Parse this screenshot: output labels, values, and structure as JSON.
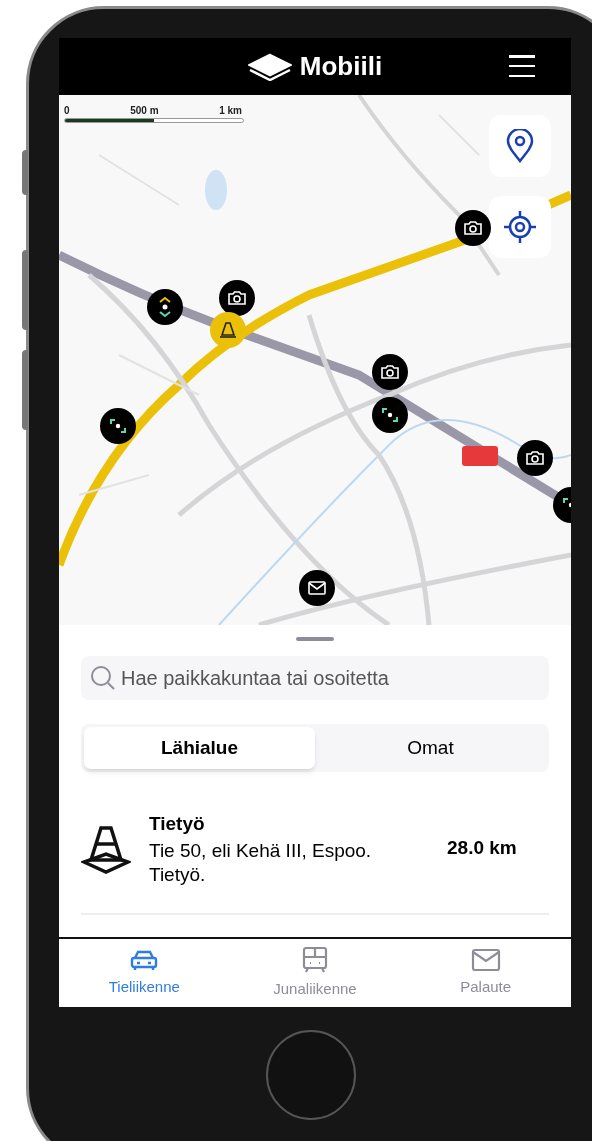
{
  "header": {
    "title": "Mobiili"
  },
  "map": {
    "kind": "picture",
    "scale": [
      "0",
      "500 m",
      "1 km"
    ]
  },
  "search": {
    "placeholder": "Hae paikkakuntaa tai osoitetta"
  },
  "segments": [
    {
      "label": "Lähialue",
      "selected": true
    },
    {
      "label": "Omat",
      "selected": false
    }
  ],
  "items": [
    {
      "title": "Tietyö",
      "description": "Tie 50, eli Kehä III, Espoo. Tietyö.",
      "distance": "28.0 km"
    }
  ],
  "tabs": [
    {
      "label": "Tieliikenne",
      "kind": "car",
      "selected": true
    },
    {
      "label": "Junaliikenne",
      "kind": "train",
      "selected": false
    },
    {
      "label": "Palaute",
      "kind": "mail",
      "selected": false
    }
  ]
}
